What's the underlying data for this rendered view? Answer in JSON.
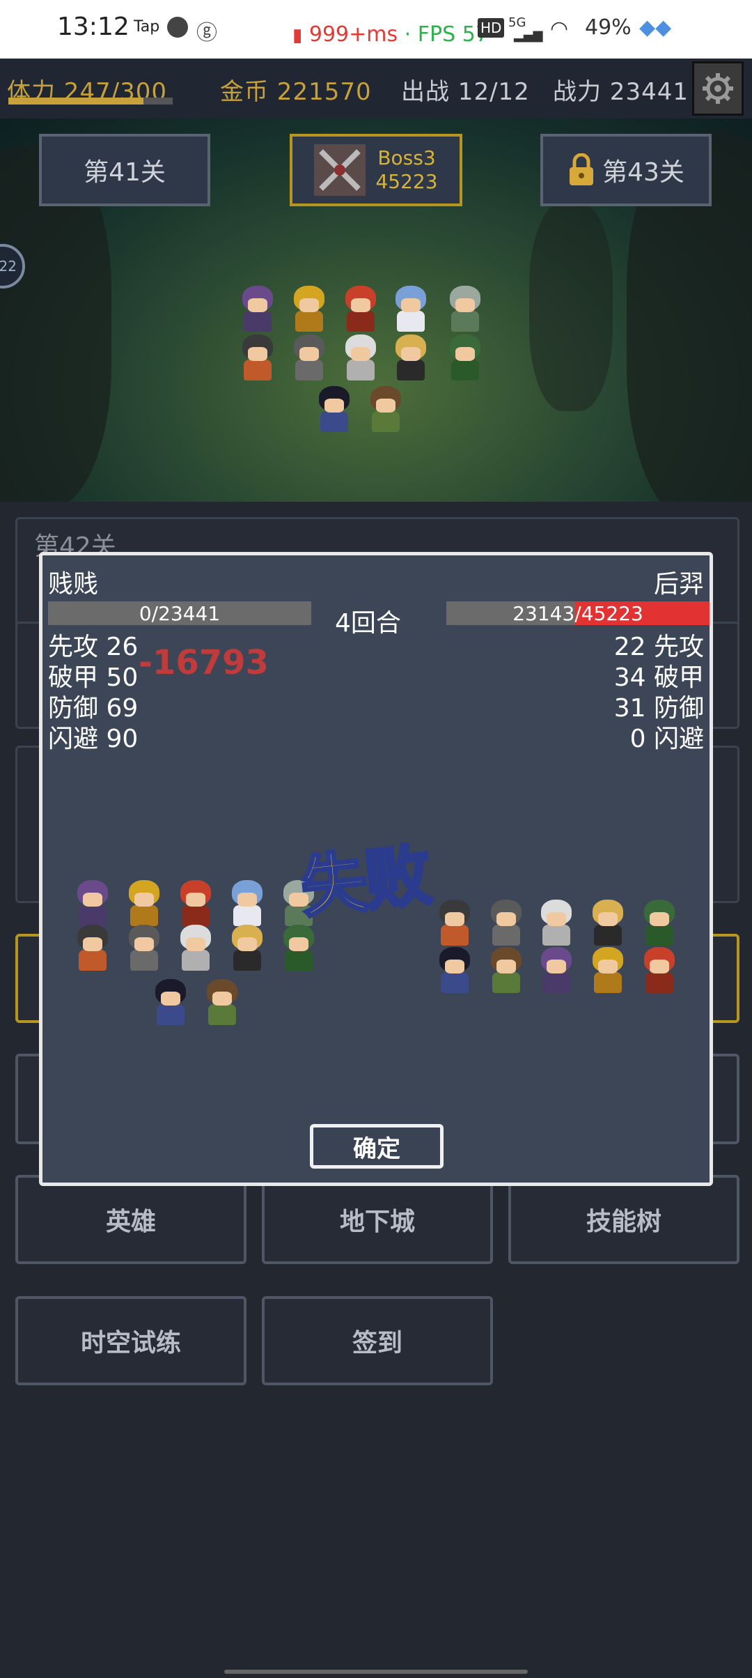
{
  "status_bar": {
    "time": "13:12",
    "tap_label": "Tap",
    "latency": "999+ms",
    "separator": "·",
    "fps": "FPS 57",
    "hd_label": "HD",
    "network": "5G",
    "battery": "49%"
  },
  "resources": {
    "stamina": "体力 247/300",
    "stamina_fraction": 0.82,
    "gold": "金币 221570",
    "deploy": "出战 12/12",
    "power": "战力 23441"
  },
  "stages": {
    "prev": "第41关",
    "boss_line1": "Boss3",
    "boss_line2": "45223",
    "next": "第43关",
    "side_badge": "22"
  },
  "background_panel": {
    "stage_title": "第42关"
  },
  "menu": {
    "heroes": "英雄",
    "dungeon": "地下城",
    "skill_tree": "技能树",
    "time_trial": "时空试练",
    "sign_in": "签到"
  },
  "battle": {
    "left_name": "贱贱",
    "right_name": "后羿",
    "left_hp": "0/23441",
    "left_hp_fraction": 0.0,
    "right_hp_current": "23143",
    "right_hp_sep": "/",
    "right_hp_max": "45223",
    "right_hp_fraction": 0.51,
    "round": "4回合",
    "damage": "-16793",
    "result": "失败",
    "confirm": "确定",
    "left_stats": [
      {
        "label": "先攻",
        "value": "26"
      },
      {
        "label": "破甲",
        "value": "50"
      },
      {
        "label": "防御",
        "value": "69"
      },
      {
        "label": "闪避",
        "value": "90"
      }
    ],
    "right_stats": [
      {
        "label": "先攻",
        "value": "22"
      },
      {
        "label": "破甲",
        "value": "34"
      },
      {
        "label": "防御",
        "value": "31"
      },
      {
        "label": "闪避",
        "value": "0"
      }
    ]
  },
  "colors": {
    "gold_text": "#c7a13a",
    "hp_red": "#e23232",
    "dialog_bg": "#3c4657"
  }
}
